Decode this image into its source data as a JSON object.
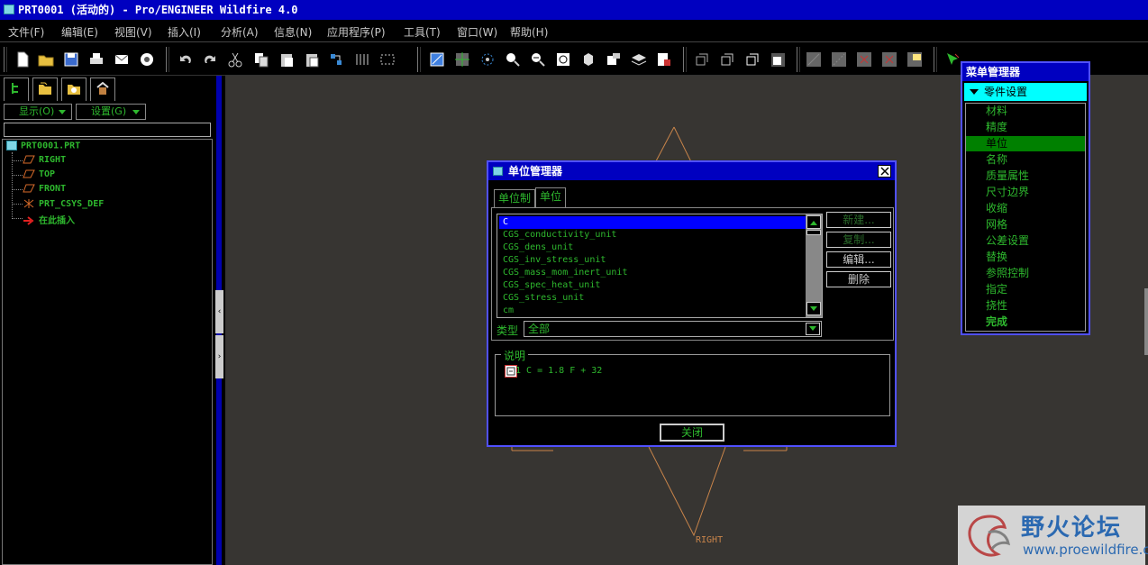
{
  "window": {
    "title": "PRT0001 (活动的) - Pro/ENGINEER Wildfire 4.0"
  },
  "menubar": {
    "items": [
      "文件(F)",
      "编辑(E)",
      "视图(V)",
      "插入(I)",
      "分析(A)",
      "信息(N)",
      "应用程序(P)",
      "工具(T)",
      "窗口(W)",
      "帮助(H)"
    ]
  },
  "left_panel": {
    "dropdowns": {
      "show": "显示(O)",
      "settings": "设置(G)"
    },
    "tree": [
      {
        "label": "PRT0001.PRT",
        "icon": "part-icon"
      },
      {
        "label": "RIGHT",
        "icon": "datum-plane-icon"
      },
      {
        "label": "TOP",
        "icon": "datum-plane-icon"
      },
      {
        "label": "FRONT",
        "icon": "datum-plane-icon"
      },
      {
        "label": "PRT_CSYS_DEF",
        "icon": "csys-icon"
      },
      {
        "label": "在此插入",
        "icon": "insert-here-arrow-icon"
      }
    ]
  },
  "canvas": {
    "datum_label": "RIGHT"
  },
  "units_dialog": {
    "title": "单位管理器",
    "tabs": [
      "单位制",
      "单位"
    ],
    "active_tab": "单位",
    "units": [
      "C",
      "CGS_conductivity_unit",
      "CGS_dens_unit",
      "CGS_inv_stress_unit",
      "CGS_mass_mom_inert_unit",
      "CGS_spec_heat_unit",
      "CGS_stress_unit",
      "cm"
    ],
    "selected_unit": "C",
    "buttons": {
      "new": "新建...",
      "copy": "复制...",
      "edit": "编辑...",
      "delete": "删除"
    },
    "type_label": "类型",
    "type_value": "全部",
    "description_label": "说明",
    "description_text": "1 C = 1.8 F + 32",
    "close_button": "关闭"
  },
  "menu_manager": {
    "title": "菜单管理器",
    "header": "零件设置",
    "items": [
      "材料",
      "精度",
      "单位",
      "名称",
      "质量属性",
      "尺寸边界",
      "收缩",
      "网格",
      "公差设置",
      "替换",
      "参照控制",
      "指定",
      "挠性",
      "完成"
    ],
    "selected": "单位"
  },
  "watermark": {
    "text": "野火论坛",
    "url": "www.proewildfire.cn"
  },
  "colors": {
    "title_bar": "#0000c0",
    "text_green": "#2eb82e",
    "canvas_bg": "#373532",
    "selection_blue": "#0000ff",
    "menu_selected": "#008000",
    "header_cyan": "#00ffff"
  }
}
